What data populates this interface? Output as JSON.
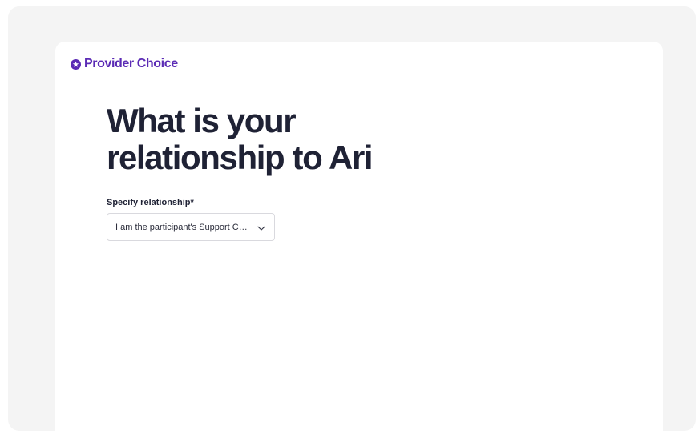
{
  "brand": {
    "name": "Provider Choice",
    "color": "#5b2bb5",
    "icon": "star-badge-icon"
  },
  "page": {
    "title": "What is your relationship to Ari"
  },
  "form": {
    "relationship_label": "Specify relationship*",
    "relationship_value": "I am the participant's Support Coordinator",
    "dropdown_icon": "chevron-down-icon"
  },
  "colors": {
    "background": "#f4f4f4",
    "card": "#ffffff",
    "heading": "#1f2235",
    "accent": "#5b2bb5"
  }
}
